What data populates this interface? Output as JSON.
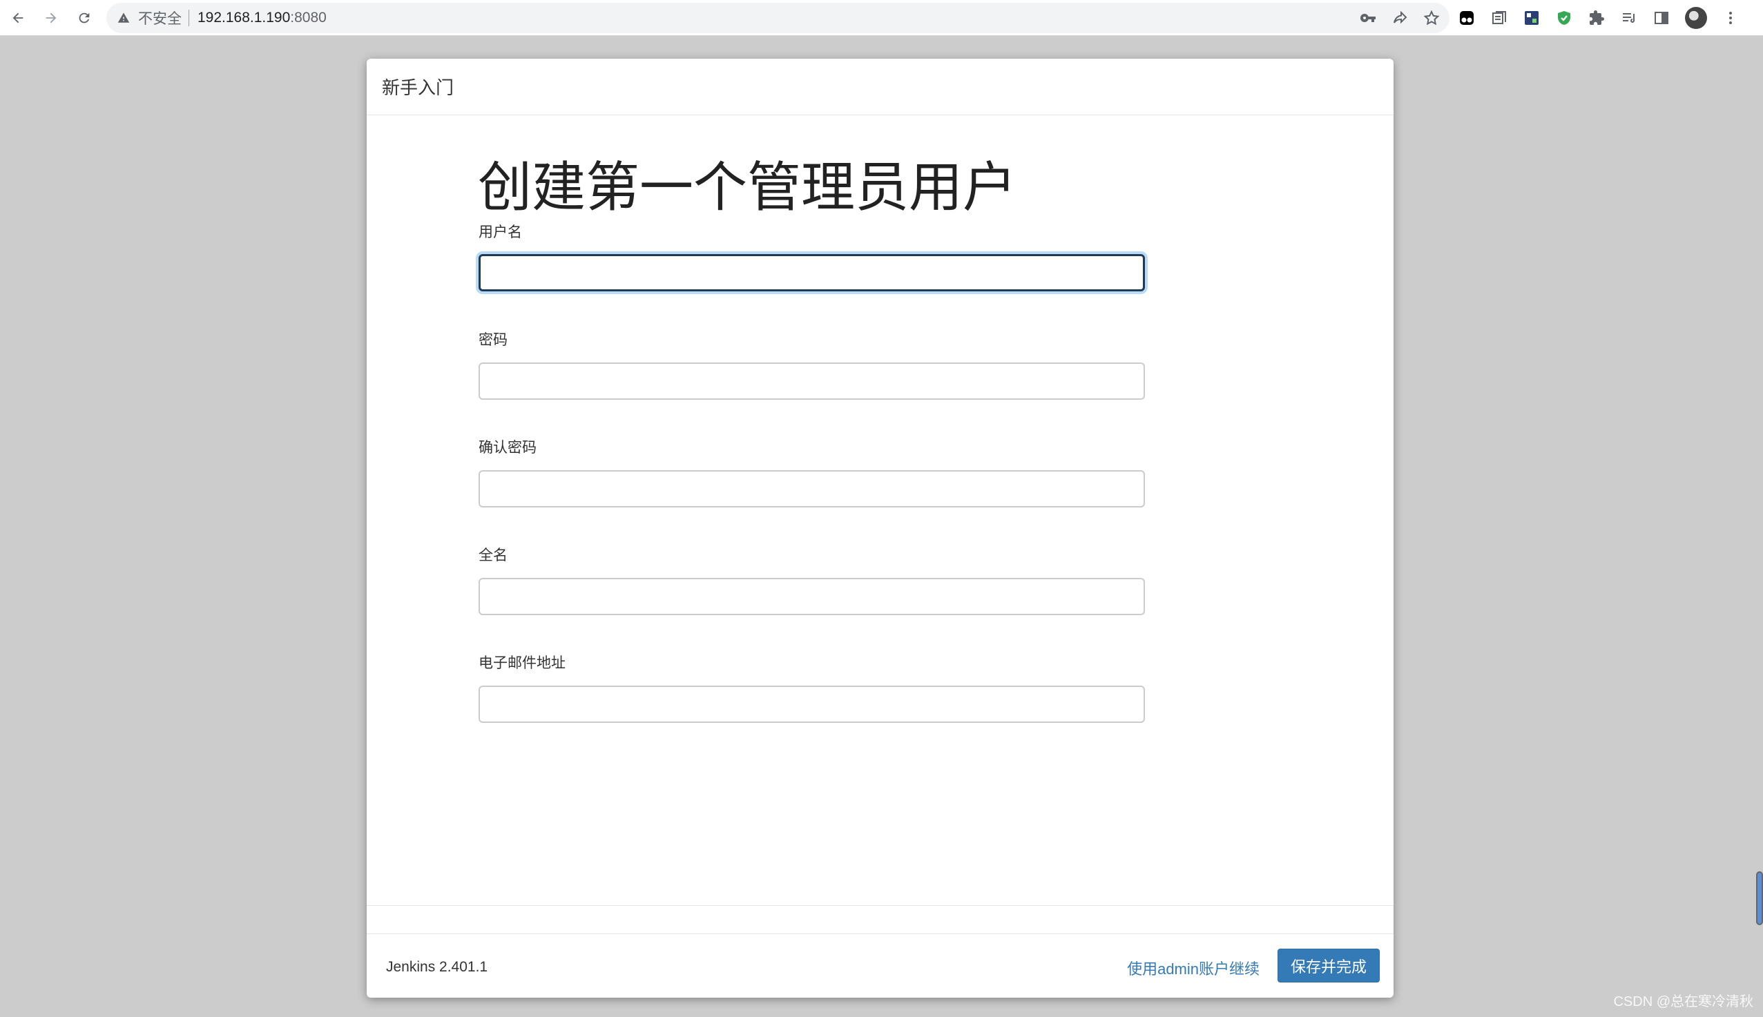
{
  "browser": {
    "security_label": "不安全",
    "url_host": "192.168.1.190",
    "url_port": ":8080",
    "icons": [
      "back-arrow-icon",
      "forward-arrow-icon",
      "reload-icon",
      "warning-icon",
      "key-icon",
      "share-icon",
      "star-icon",
      "extension-icons",
      "puzzle-icon",
      "reading-list-icon",
      "side-panel-icon",
      "avatar",
      "kebab-menu-icon"
    ]
  },
  "dialog": {
    "header_title": "新手入门",
    "page_title": "创建第一个管理员用户",
    "fields": {
      "username": {
        "label": "用户名",
        "value": ""
      },
      "password": {
        "label": "密码",
        "value": ""
      },
      "confirm_password": {
        "label": "确认密码",
        "value": ""
      },
      "full_name": {
        "label": "全名",
        "value": ""
      },
      "email": {
        "label": "电子邮件地址",
        "value": ""
      }
    },
    "footer": {
      "version": "Jenkins 2.401.1",
      "skip_link": "使用admin账户继续",
      "save_button": "保存并完成"
    }
  },
  "watermark": "CSDN @总在寒冷清秋",
  "colors": {
    "background": "#cccccc",
    "primary": "#337ab7",
    "focus_ring": "#66afe9"
  }
}
